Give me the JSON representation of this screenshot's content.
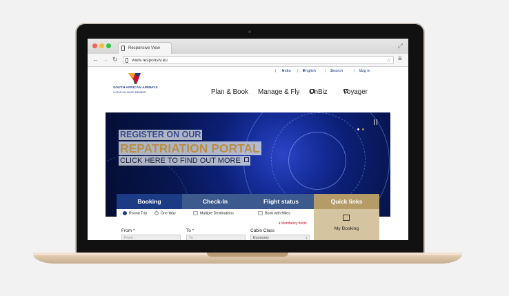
{
  "browser": {
    "tab_title": "Responsive View",
    "url": "www.responsiv.eu"
  },
  "site": {
    "brand": {
      "name": "SOUTH AFRICAN AIRWAYS",
      "tagline": "A STAR ALLIANCE MEMBER"
    },
    "top_links": {
      "country": "India",
      "language": "English",
      "search": "Search",
      "login": "Log in"
    },
    "nav": [
      "Plan & Book",
      "Manage & Fly",
      "OnBiz",
      "Voyager"
    ],
    "hero": {
      "line1": "REGISTER ON OUR",
      "line2": "REPATRIATION PORTAL",
      "line3": "CLICK HERE TO FIND OUT MORE"
    },
    "tabs": [
      "Booking",
      "Check-In",
      "Flight status",
      "Quick links"
    ],
    "booking": {
      "trip_types": [
        "Round Trip",
        "One Way"
      ],
      "multiple_destinations": "Multiple Destinations",
      "book_with_miles": "Book with Miles",
      "mandatory": "Mandatory fields",
      "from_label": "From",
      "from_placeholder": "From",
      "to_label": "To",
      "to_placeholder": "To",
      "cabin_label": "Cabin Class",
      "cabin_value": "Economy"
    },
    "quick_links": {
      "my_booking": "My Booking"
    }
  },
  "colors": {
    "brand_navy": "#1b3c84",
    "tab_booking": "#1b3c84",
    "tab_other": "#3c5a8e",
    "quick_links": "#b59b68",
    "accent_gold": "#b98e43",
    "mandatory_red": "#c8102e"
  }
}
